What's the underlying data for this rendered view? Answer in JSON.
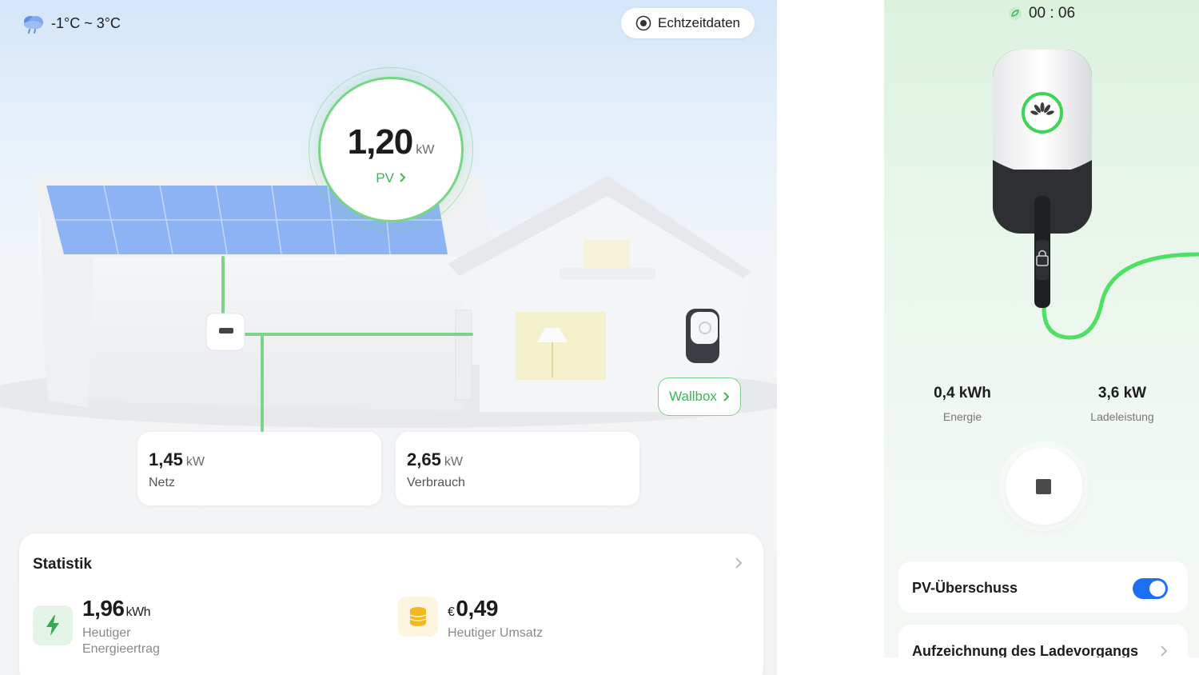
{
  "weather": {
    "icon": "cloud-rain-icon",
    "range": "-1°C ~ 3°C"
  },
  "realtime": {
    "label": "Echtzeitdaten",
    "icon": "radio-target-icon"
  },
  "pv": {
    "value": "1,20",
    "unit": "kW",
    "link_label": "PV"
  },
  "wallbox_link": {
    "label": "Wallbox"
  },
  "grid": {
    "value": "1,45",
    "unit": "kW",
    "label": "Netz"
  },
  "consumption": {
    "value": "2,65",
    "unit": "kW",
    "label": "Verbrauch"
  },
  "statistics": {
    "title": "Statistik",
    "energy_yield": {
      "value": "1,96",
      "unit": "kWh",
      "label_line1": "Heutiger",
      "label_line2": "Energieertrag",
      "icon": "lightning-icon"
    },
    "revenue": {
      "currency": "€",
      "value": "0,49",
      "label": "Heutiger Umsatz",
      "icon": "coins-icon"
    }
  },
  "charger": {
    "timer": "00 : 06",
    "timer_icon": "leaf-icon",
    "energy": {
      "value": "0,4 kWh",
      "label": "Energie"
    },
    "power": {
      "value": "3,6 kW",
      "label": "Ladeleistung"
    },
    "pv_surplus": {
      "label": "PV-Überschuss",
      "enabled": true
    },
    "charging_record": {
      "label": "Aufzeichnung des Ladevorgangs"
    }
  },
  "colors": {
    "accent_green": "#3fb45a",
    "toggle_blue": "#1c6ef2",
    "panel_blue": "#8eb3f5"
  }
}
